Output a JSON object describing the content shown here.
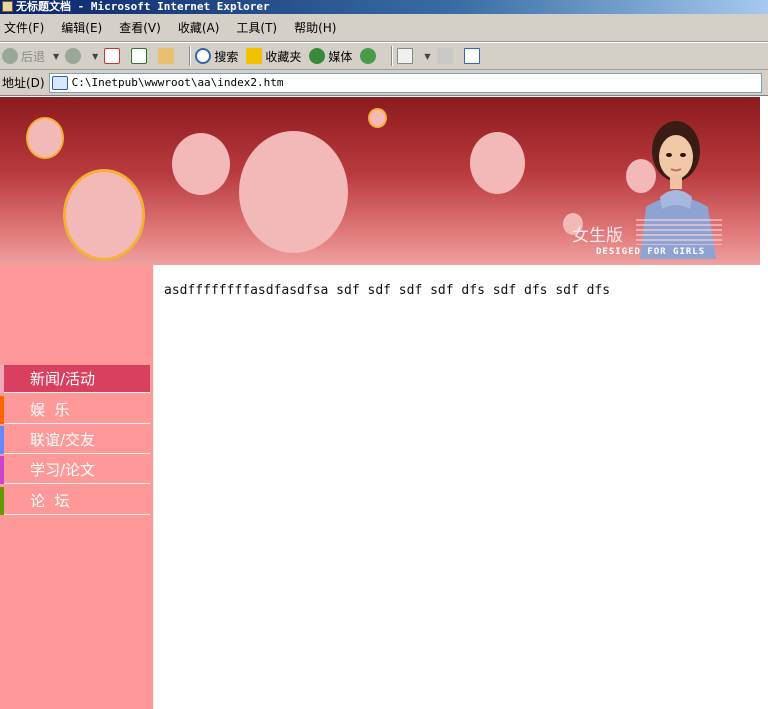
{
  "window": {
    "title": "无标题文档 - Microsoft Internet Explorer"
  },
  "menubar": {
    "items": [
      "文件(F)",
      "编辑(E)",
      "查看(V)",
      "收藏(A)",
      "工具(T)",
      "帮助(H)"
    ]
  },
  "toolbar": {
    "back_label": "后退",
    "search_label": "搜索",
    "favorites_label": "收藏夹",
    "media_label": "媒体"
  },
  "addressbar": {
    "label": "地址(D)",
    "url": "C:\\Inetpub\\wwwroot\\aa\\index2.htm"
  },
  "banner": {
    "title": "女生版",
    "subtitle": "DESIGED FOR GIRLS"
  },
  "sidebar": {
    "items": [
      {
        "label": "新闻/活动",
        "accent": "#d93f5f",
        "active": true
      },
      {
        "label": "娱  乐",
        "accent": "#ff6600",
        "active": false
      },
      {
        "label": "联谊/交友",
        "accent": "#6688ff",
        "active": false
      },
      {
        "label": "学习/论文",
        "accent": "#cc44cc",
        "active": false
      },
      {
        "label": "论  坛",
        "accent": "#669900",
        "active": false
      }
    ]
  },
  "content": {
    "text": "asdffffffffasdfasdfsa sdf sdf sdf sdf dfs sdf dfs sdf dfs"
  },
  "colors": {
    "sidebar_bg": "#ff9999",
    "banner_dark": "#8d1a1e",
    "active_item": "#d93f5f"
  }
}
